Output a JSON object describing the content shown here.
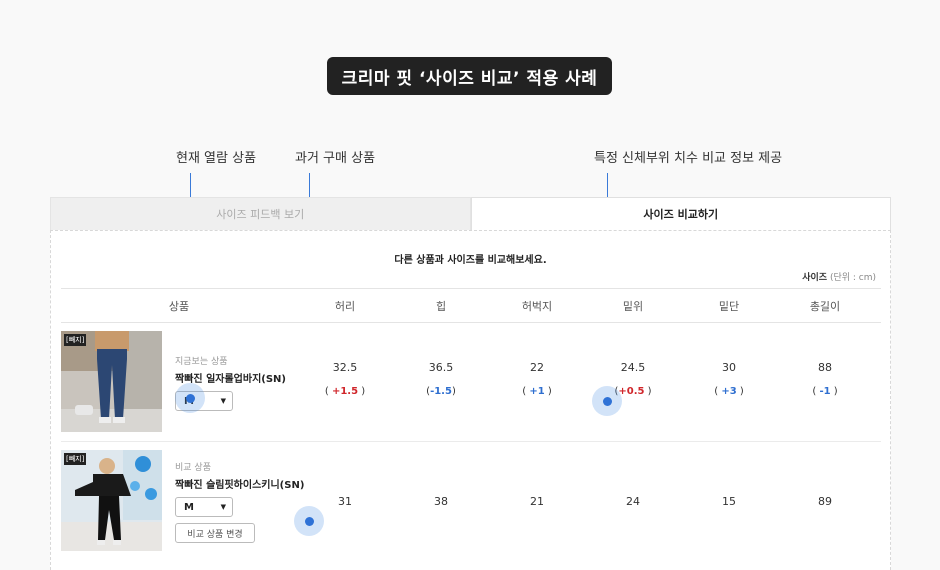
{
  "title": "크리마 핏 ‘사이즈 비교’ 적용 사례",
  "callouts": {
    "current": "현재 열람 상품",
    "past": "과거 구매 상품",
    "specific": "특정 신체부위 치수 비교 정보 제공"
  },
  "tabs": {
    "feedback": "사이즈 피드백 보기",
    "compare": "사이즈 비교하기"
  },
  "subheading": "다른 상품과 사이즈를 비교해보세요.",
  "unit": {
    "label": "사이즈",
    "unit": "(단위 : cm)"
  },
  "headers": [
    "상품",
    "허리",
    "힙",
    "허벅지",
    "밑위",
    "밑단",
    "총길이"
  ],
  "products": [
    {
      "tag": "[빼지]",
      "label": "지금보는 상품",
      "name": "짝빠진 일자롤업바지(SN)",
      "size": "M",
      "values": [
        "32.5",
        "36.5",
        "22",
        "24.5",
        "30",
        "88"
      ],
      "diffs": [
        {
          "text": "+1.5",
          "sign": "pos"
        },
        {
          "text": "-1.5",
          "sign": "neg"
        },
        {
          "text": "+1",
          "sign": "neg"
        },
        {
          "text": "+0.5",
          "sign": "pos"
        },
        {
          "text": "+3",
          "sign": "neg"
        },
        {
          "text": "-1",
          "sign": "neg"
        }
      ]
    },
    {
      "tag": "[빼지]",
      "label": "비교 상품",
      "name": "짝빠진 슬림핏하이스키니(SN)",
      "size": "M",
      "change_button": "비교 상품 변경",
      "values": [
        "31",
        "38",
        "21",
        "24",
        "15",
        "89"
      ]
    }
  ],
  "colors": {
    "accent": "#2f72d6",
    "positive": "#d0262b",
    "negative": "#2f6fd0"
  }
}
